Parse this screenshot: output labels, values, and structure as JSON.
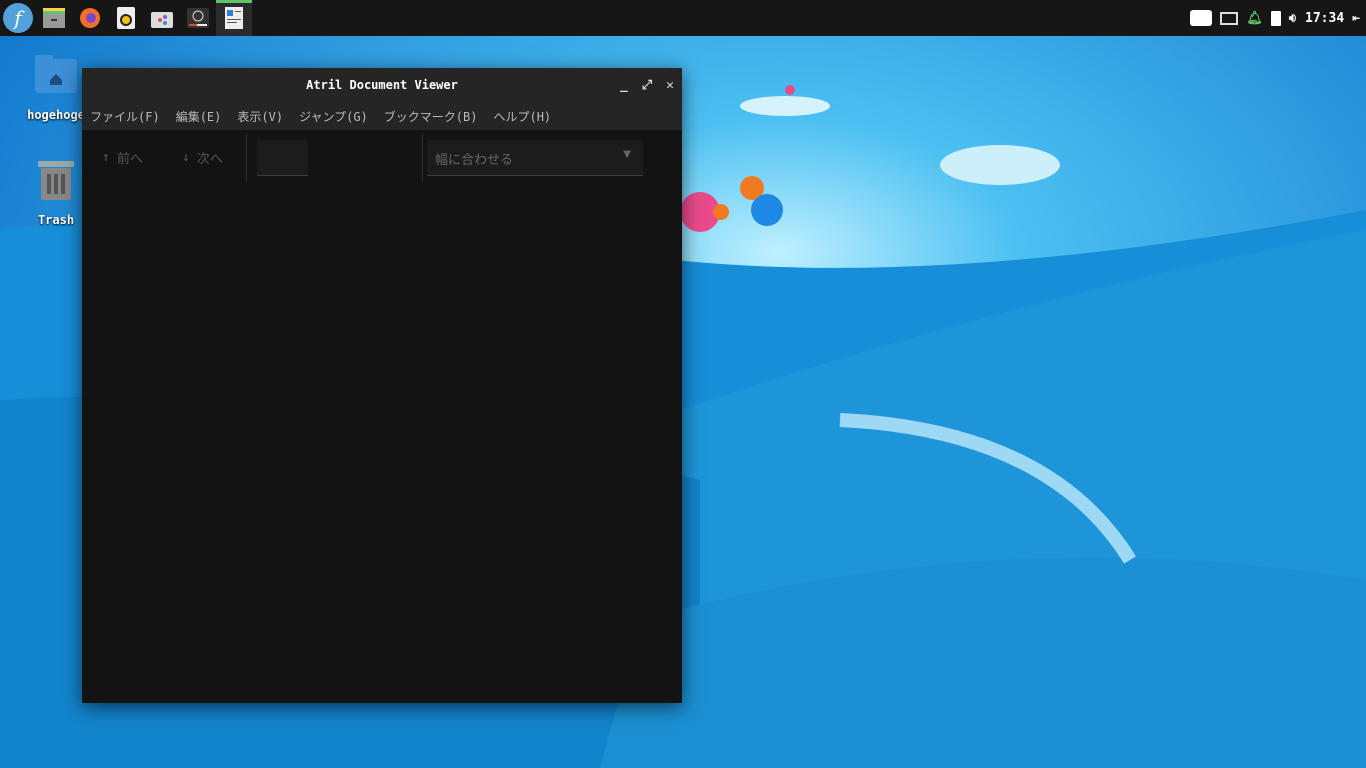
{
  "panel": {
    "launchers": [
      {
        "name": "fedora-menu-icon"
      },
      {
        "name": "file-manager-icon"
      },
      {
        "name": "firefox-icon"
      },
      {
        "name": "rhythmbox-icon"
      },
      {
        "name": "software-icon"
      },
      {
        "name": "media-player-icon"
      },
      {
        "name": "document-viewer-icon",
        "active": true
      }
    ],
    "tray": {
      "icons": [
        "keyboard-icon",
        "network-icon",
        "notification-bell-icon",
        "battery-charging-icon",
        "volume-icon",
        "logout-icon"
      ],
      "clock": "17:34"
    },
    "accent": "#5fc46b"
  },
  "desktop": {
    "icons": [
      {
        "label": "hogehoge",
        "icon": "home-folder-icon"
      },
      {
        "label": "Trash",
        "icon": "trash-icon"
      }
    ]
  },
  "window": {
    "title": "Atril Document Viewer",
    "menu": [
      "ファイル(F)",
      "編集(E)",
      "表示(V)",
      "ジャンプ(G)",
      "ブックマーク(B)",
      "ヘルプ(H)"
    ],
    "toolbar": {
      "prev": "前へ",
      "next": "次へ",
      "page_value": "",
      "zoom": "幅に合わせる"
    }
  }
}
